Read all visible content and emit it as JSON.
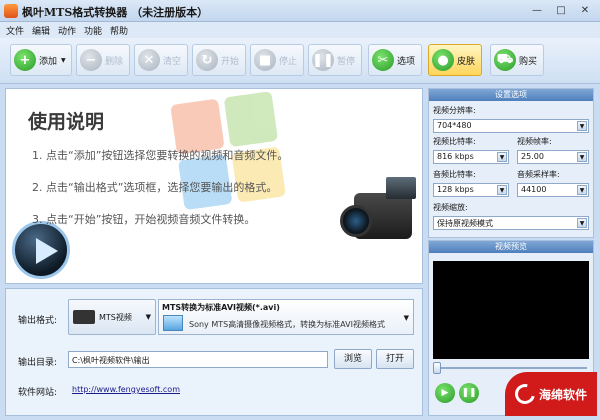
{
  "window": {
    "title": "枫叶MTS格式转换器 （未注册版本）",
    "minimize": "—",
    "maximize": "□",
    "close": "✕"
  },
  "menu": {
    "items": [
      "文件",
      "编辑",
      "动作",
      "功能",
      "帮助"
    ]
  },
  "toolbar": {
    "add": {
      "label": "添加",
      "icon": "plus-icon"
    },
    "delete": {
      "label": "删除",
      "icon": "minus-icon"
    },
    "clear": {
      "label": "清空",
      "icon": "clear-icon"
    },
    "start": {
      "label": "开始",
      "icon": "refresh-icon"
    },
    "stop": {
      "label": "停止",
      "icon": "stop-icon"
    },
    "pause": {
      "label": "暂停",
      "icon": "pause-icon"
    },
    "options": {
      "label": "选项",
      "icon": "tools-icon"
    },
    "skin": {
      "label": "皮肤",
      "icon": "apple-icon"
    },
    "buy": {
      "label": "购买",
      "icon": "cart-icon"
    }
  },
  "usage": {
    "title": "使用说明",
    "steps": [
      "1. 点击“添加”按钮选择您要转换的视频和音频文件。",
      "2. 点击“输出格式”选项框，选择您要输出的格式。",
      "3. 点击“开始”按钮，开始视频音频文件转换。"
    ]
  },
  "output": {
    "format_label": "输出格式:",
    "format_name": "MTS视频",
    "format_title": "MTS转换为标准AVI视频(*.avi)",
    "format_desc": "Sony MTS高清摄像视频格式，转换为标准AVI视频格式",
    "dir_label": "输出目录:",
    "dir_value": "C:\\枫叶视频软件\\输出",
    "browse": "浏览",
    "open": "打开",
    "website_label": "软件网站:",
    "website": "http://www.fengyesoft.com"
  },
  "settings": {
    "header": "设置选项",
    "resolution_label": "视频分辨率:",
    "resolution": "704*480",
    "vbitrate_label": "视频比特率:",
    "vbitrate": "816 kbps",
    "framerate_label": "视频帧率:",
    "framerate": "25.00",
    "abitrate_label": "音频比特率:",
    "abitrate": "128 kbps",
    "samplerate_label": "音频采样率:",
    "samplerate": "44100",
    "scale_label": "视频缩放:",
    "scale": "保持原视频模式"
  },
  "preview": {
    "header": "视频预览"
  },
  "watermark": {
    "text": "海绵软件"
  },
  "colors": {
    "accent": "#4f7fbc",
    "window_bg": "#c9dcf2",
    "watermark_red": "#d11b1b"
  }
}
